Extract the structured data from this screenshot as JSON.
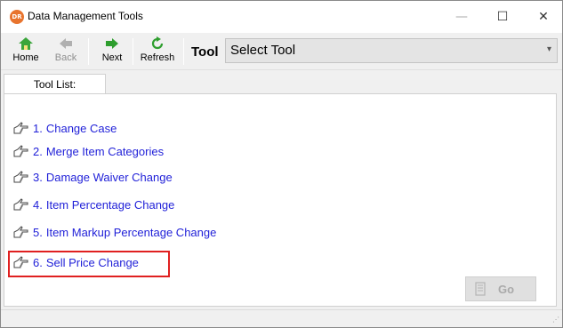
{
  "window": {
    "app_icon_text": "DR",
    "title": "Data Management Tools",
    "minimize_glyph": "—",
    "maximize_glyph": "☐",
    "close_glyph": "✕"
  },
  "toolbar": {
    "home_label": "Home",
    "back_label": "Back",
    "next_label": "Next",
    "refresh_label": "Refresh",
    "tool_label": "Tool",
    "tool_select_value": "Select Tool"
  },
  "tab": {
    "label": "Tool List:"
  },
  "tools": [
    {
      "number": "1.",
      "label": "Change Case"
    },
    {
      "number": "2.",
      "label": "Merge Item Categories"
    },
    {
      "number": "3.",
      "label": "Damage Waiver Change"
    },
    {
      "number": "4.",
      "label": "Item Percentage Change"
    },
    {
      "number": "5.",
      "label": "Item Markup Percentage Change"
    },
    {
      "number": "6.",
      "label": "Sell Price Change"
    }
  ],
  "go_button": {
    "label": "Go",
    "enabled": false
  },
  "icons": {
    "app": "app-logo-icon",
    "home": "home-icon",
    "back": "back-arrow-icon",
    "next": "next-arrow-icon",
    "refresh": "refresh-icon",
    "tool_item": "pointing-hand-icon",
    "go": "go-icon"
  },
  "colors": {
    "link": "#1f1fd8",
    "highlight": "#e02020",
    "home_green": "#3aa53a",
    "disabled": "#8f8f8f"
  },
  "selected_tool_index": 5
}
